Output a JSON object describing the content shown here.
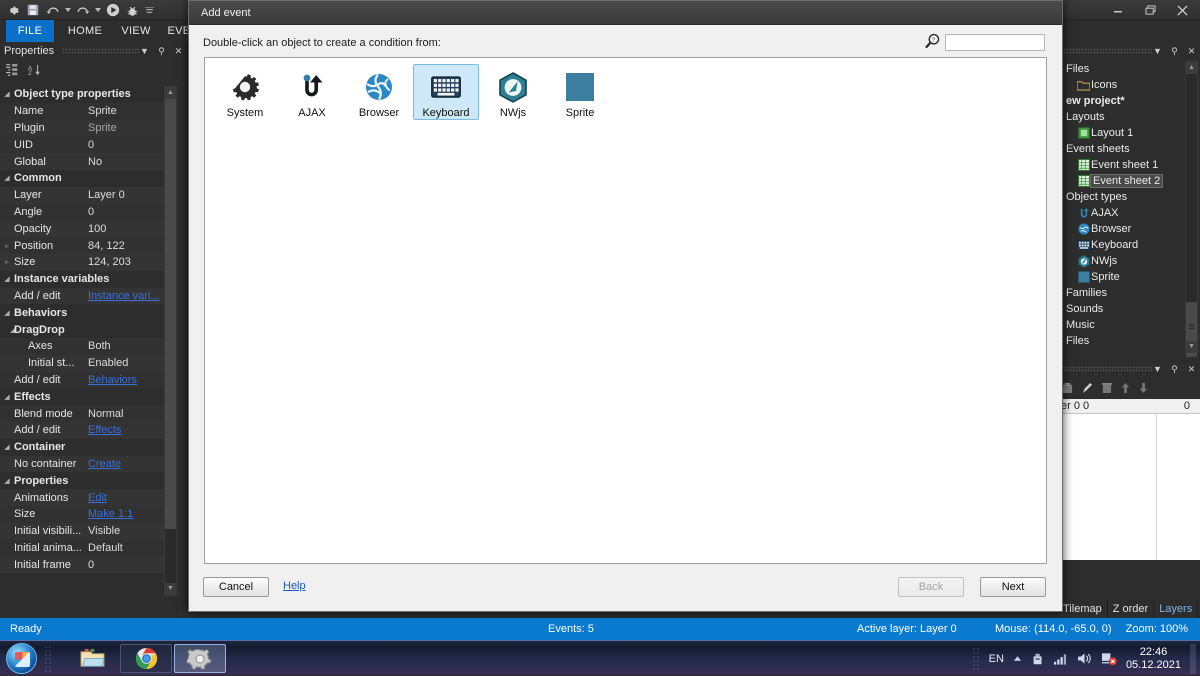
{
  "app": {
    "quick_access_icons": [
      "gear-icon",
      "save-icon",
      "undo-icon",
      "undo-dropdown-icon",
      "redo-icon",
      "redo-dropdown-icon",
      "play-icon",
      "debug-icon",
      "customize-icon"
    ],
    "window_buttons": [
      "minimize",
      "restore",
      "close"
    ],
    "ribbon_tabs": [
      {
        "label": "FILE",
        "active": true
      },
      {
        "label": "HOME",
        "active": false
      },
      {
        "label": "VIEW",
        "active": false
      },
      {
        "label": "EVE",
        "active": false
      }
    ]
  },
  "properties_panel": {
    "title": "Properties",
    "header_buttons": [
      "chevron-down-icon",
      "pin-icon",
      "close-icon"
    ],
    "toolbar_icons": [
      "categorized-icon",
      "alphabetical-sort-icon"
    ],
    "rows": [
      {
        "kind": "group",
        "expander": "◢",
        "name": "Object type properties",
        "value": ""
      },
      {
        "kind": "item",
        "name": "Name",
        "value": "Sprite"
      },
      {
        "kind": "item",
        "name": "Plugin",
        "value": "Sprite",
        "style": "muted"
      },
      {
        "kind": "item",
        "name": "UID",
        "value": "0"
      },
      {
        "kind": "item",
        "name": "Global",
        "value": "No"
      },
      {
        "kind": "group",
        "expander": "◢",
        "name": "Common",
        "value": ""
      },
      {
        "kind": "item",
        "name": "Layer",
        "value": "Layer 0"
      },
      {
        "kind": "item",
        "name": "Angle",
        "value": "0"
      },
      {
        "kind": "item",
        "name": "Opacity",
        "value": "100"
      },
      {
        "kind": "item",
        "expander": "▹",
        "name": "Position",
        "value": "84, 122"
      },
      {
        "kind": "item",
        "expander": "▹",
        "name": "Size",
        "value": "124, 203"
      },
      {
        "kind": "group",
        "expander": "◢",
        "name": "Instance variables",
        "value": ""
      },
      {
        "kind": "item",
        "name": "Add / edit",
        "value": "Instance vari...",
        "style": "link"
      },
      {
        "kind": "group",
        "expander": "◢",
        "name": "Behaviors",
        "value": ""
      },
      {
        "kind": "subgroup",
        "expander": "◢",
        "name": "DragDrop",
        "value": ""
      },
      {
        "kind": "sub",
        "name": "Axes",
        "value": "Both"
      },
      {
        "kind": "sub",
        "name": "Initial st...",
        "value": "Enabled"
      },
      {
        "kind": "item",
        "name": "Add / edit",
        "value": "Behaviors",
        "style": "link"
      },
      {
        "kind": "group",
        "expander": "◢",
        "name": "Effects",
        "value": ""
      },
      {
        "kind": "item",
        "name": "Blend mode",
        "value": "Normal"
      },
      {
        "kind": "item",
        "name": "Add / edit",
        "value": "Effects",
        "style": "link"
      },
      {
        "kind": "group",
        "expander": "◢",
        "name": "Container",
        "value": ""
      },
      {
        "kind": "item",
        "name": "No container",
        "value": "Create",
        "style": "link"
      },
      {
        "kind": "group",
        "expander": "◢",
        "name": "Properties",
        "value": ""
      },
      {
        "kind": "item",
        "name": "Animations",
        "value": "Edit",
        "style": "link"
      },
      {
        "kind": "item",
        "name": "Size",
        "value": "Make 1:1",
        "style": "link"
      },
      {
        "kind": "item",
        "name": "Initial visibili...",
        "value": "Visible"
      },
      {
        "kind": "item",
        "name": "Initial anima...",
        "value": "Default"
      },
      {
        "kind": "item",
        "name": "Initial frame",
        "value": "0"
      }
    ]
  },
  "project_panel": {
    "header_buttons": [
      "chevron-down-icon",
      "pin-icon",
      "close-icon"
    ],
    "nodes": [
      {
        "label": "Files",
        "icon": "",
        "indent": 0,
        "twisty": "▹",
        "bold": false
      },
      {
        "label": "Icons",
        "icon": "folder-icon",
        "indent": 1,
        "twisty": "",
        "bold": false
      },
      {
        "label": "ew project*",
        "icon": "",
        "indent": 0,
        "twisty": "",
        "bold": true
      },
      {
        "label": "Layouts",
        "icon": "",
        "indent": 0,
        "twisty": "▹",
        "bold": false
      },
      {
        "label": "Layout 1",
        "icon": "layout-icon",
        "indent": 1,
        "twisty": "",
        "bold": false
      },
      {
        "label": "Event sheets",
        "icon": "",
        "indent": 0,
        "twisty": "▹",
        "bold": false
      },
      {
        "label": "Event sheet 1",
        "icon": "eventsheet-icon",
        "indent": 1,
        "twisty": "",
        "bold": false
      },
      {
        "label": "Event sheet 2",
        "icon": "eventsheet-icon",
        "indent": 1,
        "twisty": "",
        "bold": false,
        "selected": true
      },
      {
        "label": "Object types",
        "icon": "",
        "indent": 0,
        "twisty": "▹",
        "bold": false
      },
      {
        "label": "AJAX",
        "icon": "ajax-icon",
        "indent": 1,
        "twisty": "",
        "bold": false
      },
      {
        "label": "Browser",
        "icon": "browser-icon",
        "indent": 1,
        "twisty": "",
        "bold": false
      },
      {
        "label": "Keyboard",
        "icon": "keyboard-icon",
        "indent": 1,
        "twisty": "",
        "bold": false
      },
      {
        "label": "NWjs",
        "icon": "nwjs-icon",
        "indent": 1,
        "twisty": "",
        "bold": false
      },
      {
        "label": "Sprite",
        "icon": "sprite-icon",
        "indent": 1,
        "twisty": "",
        "bold": false
      },
      {
        "label": "Families",
        "icon": "",
        "indent": 0,
        "twisty": "▹",
        "bold": false
      },
      {
        "label": "Sounds",
        "icon": "",
        "indent": 0,
        "twisty": "▹",
        "bold": false
      },
      {
        "label": "Music",
        "icon": "",
        "indent": 0,
        "twisty": "▹",
        "bold": false
      },
      {
        "label": "Files",
        "icon": "",
        "indent": 0,
        "twisty": "▹",
        "bold": false
      }
    ]
  },
  "layers_panel": {
    "header_buttons": [
      "chevron-down-icon",
      "pin-icon",
      "close-icon"
    ],
    "toolbar_icons": [
      "add-layer-icon",
      "rename-icon",
      "delete-icon",
      "move-up-icon",
      "move-down-icon"
    ],
    "column_left": "er 0",
    "column_left_value": "0",
    "column_right_value": "0"
  },
  "dock_tabs": [
    {
      "label": "Tilemap",
      "active": false
    },
    {
      "label": "Z order",
      "active": false
    },
    {
      "label": "Layers",
      "active": true
    }
  ],
  "statusbar": {
    "ready": "Ready",
    "events": "Events: 5",
    "active_layer": "Active layer: Layer 0",
    "mouse": "Mouse: (114.0, -65.0, 0)",
    "zoom": "Zoom: 100%"
  },
  "taskbar": {
    "start_label": "start-orb",
    "items": [
      {
        "name": "taskbar-explorer",
        "icon": "folder-icon",
        "active": false
      },
      {
        "name": "taskbar-chrome",
        "icon": "chrome-icon",
        "active": false
      },
      {
        "name": "taskbar-construct2",
        "icon": "gear-icon",
        "active": true
      }
    ],
    "tray": {
      "language": "EN",
      "show_hidden_icon": "chevron-up-icon",
      "icons": [
        "flash-drive-icon",
        "network-icon",
        "volume-icon",
        "action-center-icon"
      ],
      "time": "22:46",
      "date": "05.12.2021"
    }
  },
  "dialog": {
    "title": "Add event",
    "prompt": "Double-click an object to create a condition from:",
    "search": {
      "icon": "search-icon",
      "value": "",
      "placeholder": ""
    },
    "objects": [
      {
        "label": "System",
        "icon": "system-gear-icon",
        "selected": false
      },
      {
        "label": "AJAX",
        "icon": "ajax-icon",
        "selected": false
      },
      {
        "label": "Browser",
        "icon": "browser-globe-icon",
        "selected": false
      },
      {
        "label": "Keyboard",
        "icon": "keyboard-icon",
        "selected": true
      },
      {
        "label": "NWjs",
        "icon": "nwjs-icon",
        "selected": false
      },
      {
        "label": "Sprite",
        "icon": "sprite-square-icon",
        "selected": false
      }
    ],
    "buttons": {
      "cancel": "Cancel",
      "help": "Help",
      "back": "Back",
      "back_disabled": true,
      "next": "Next"
    }
  },
  "colors": {
    "accent_status": "#0a7ad0",
    "ribbon_active": "#0a70c8",
    "selection_blue": "#cde8f7",
    "link_blue": "#1a56c4",
    "panel_dark": "#2d2d2d",
    "sprite_teal": "#2d7f9e"
  }
}
